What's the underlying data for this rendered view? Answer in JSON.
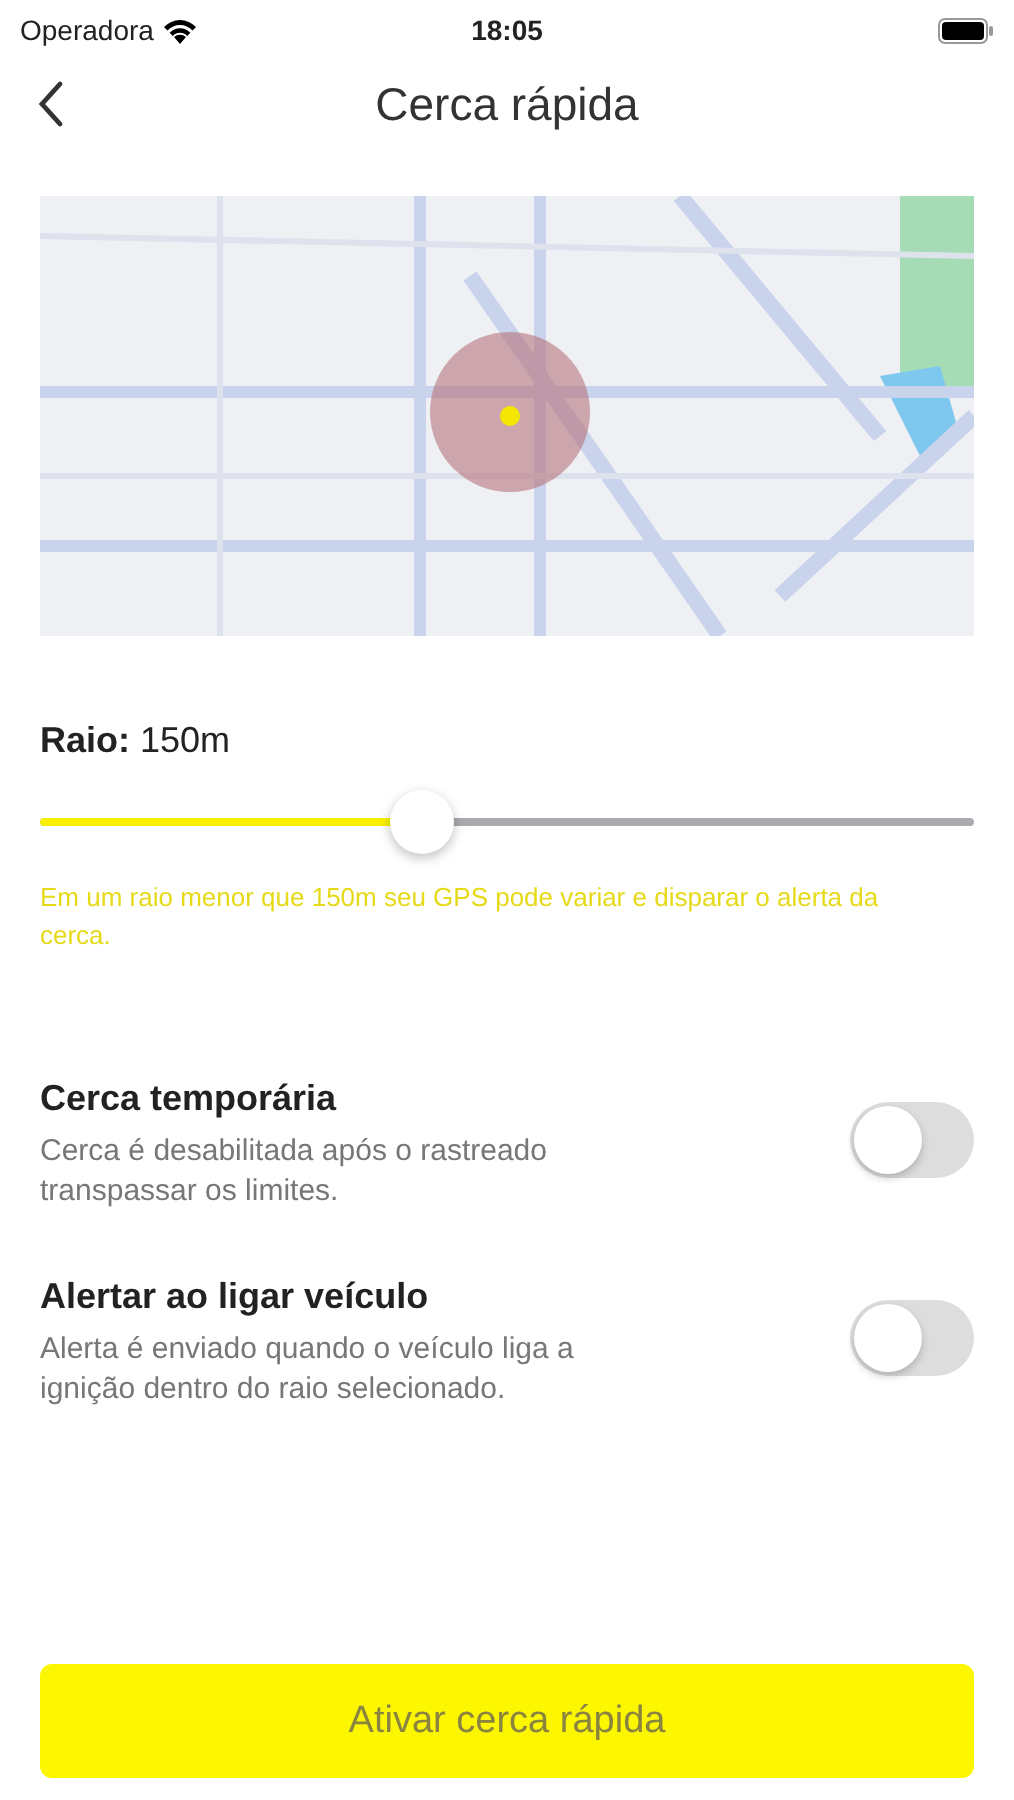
{
  "status_bar": {
    "carrier": "Operadora",
    "time": "18:05"
  },
  "nav": {
    "title": "Cerca rápida"
  },
  "radius": {
    "label": "Raio:",
    "value": "150m",
    "level": 0.41,
    "warning": "Em um raio menor que 150m seu GPS pode variar e disparar o alerta da cerca."
  },
  "options": [
    {
      "title": "Cerca temporária",
      "description": "Cerca é desabilitada após o rastreado transpassar os limites.",
      "on": false
    },
    {
      "title": "Alertar ao ligar veículo",
      "description": "Alerta é enviado quando o veículo liga a ignição dentro do raio selecionado.",
      "on": false
    }
  ],
  "button": {
    "label": "Ativar cerca rápida",
    "disabled": true
  }
}
